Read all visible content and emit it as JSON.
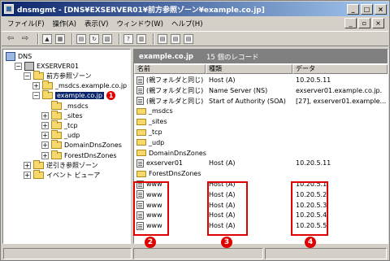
{
  "window": {
    "title": "dnsmgmt - [DNS¥EXSERVER01¥前方参照ゾーン¥example.co.jp]",
    "controls": {
      "minimize": "_",
      "maximize": "□",
      "close": "×"
    },
    "mdi_controls": {
      "minimize": "_",
      "restore": "▫",
      "close": "×"
    }
  },
  "menu": [
    "ファイル(F)",
    "操作(A)",
    "表示(V)",
    "ウィンドウ(W)",
    "ヘルプ(H)"
  ],
  "toolbar": {
    "back_glyph": "⇦",
    "forward_glyph": "⇨",
    "icons": [
      "up-folder",
      "show-tree",
      "properties",
      "refresh",
      "export-list",
      "help",
      "console-view",
      "new-host",
      "new-alias",
      "new-mail-exchanger"
    ]
  },
  "tree": [
    {
      "label": "DNS",
      "indent": 0,
      "icon": "dns-root",
      "expander": ""
    },
    {
      "label": "EXSERVER01",
      "indent": 1,
      "icon": "server",
      "expander": "−"
    },
    {
      "label": "前方参照ゾーン",
      "indent": 2,
      "icon": "folder",
      "expander": "−"
    },
    {
      "label": "_msdcs.example.co.jp",
      "indent": 3,
      "icon": "folder",
      "expander": "+"
    },
    {
      "label": "example.co.jp",
      "indent": 3,
      "icon": "folder",
      "expander": "−",
      "selected": true,
      "marker": "1"
    },
    {
      "label": "_msdcs",
      "indent": 4,
      "icon": "folder",
      "expander": ""
    },
    {
      "label": "_sites",
      "indent": 4,
      "icon": "folder",
      "expander": "+"
    },
    {
      "label": "_tcp",
      "indent": 4,
      "icon": "folder",
      "expander": "+"
    },
    {
      "label": "_udp",
      "indent": 4,
      "icon": "folder",
      "expander": "+"
    },
    {
      "label": "DomainDnsZones",
      "indent": 4,
      "icon": "folder",
      "expander": "+"
    },
    {
      "label": "ForestDnsZones",
      "indent": 4,
      "icon": "folder",
      "expander": "+"
    },
    {
      "label": "逆引き参照ゾーン",
      "indent": 2,
      "icon": "folder",
      "expander": "+"
    },
    {
      "label": "イベント ビューア",
      "indent": 2,
      "icon": "folder",
      "expander": "+"
    }
  ],
  "zone_header": {
    "name": "example.co.jp",
    "count": "15 個のレコード"
  },
  "columns": [
    "名前",
    "種類",
    "データ"
  ],
  "records": [
    {
      "icon": "record",
      "name": "(親フォルダと同じ)",
      "type": "Host (A)",
      "data": "10.20.5.11"
    },
    {
      "icon": "record",
      "name": "(親フォルダと同じ)",
      "type": "Name Server (NS)",
      "data": "exserver01.example.co.jp."
    },
    {
      "icon": "record",
      "name": "(親フォルダと同じ)",
      "type": "Start of Authority (SOA)",
      "data": "[27], exserver01.example..."
    },
    {
      "icon": "folder",
      "name": "_msdcs",
      "type": "",
      "data": ""
    },
    {
      "icon": "folder",
      "name": "_sites",
      "type": "",
      "data": ""
    },
    {
      "icon": "folder",
      "name": "_tcp",
      "type": "",
      "data": ""
    },
    {
      "icon": "folder",
      "name": "_udp",
      "type": "",
      "data": ""
    },
    {
      "icon": "folder",
      "name": "DomainDnsZones",
      "type": "",
      "data": ""
    },
    {
      "icon": "record",
      "name": "exserver01",
      "type": "Host (A)",
      "data": "10.20.5.11"
    },
    {
      "icon": "folder",
      "name": "ForestDnsZones",
      "type": "",
      "data": ""
    },
    {
      "icon": "record",
      "name": "www",
      "type": "Host (A)",
      "data": "10.20.5.1"
    },
    {
      "icon": "record",
      "name": "www",
      "type": "Host (A)",
      "data": "10.20.5.2"
    },
    {
      "icon": "record",
      "name": "www",
      "type": "Host (A)",
      "data": "10.20.5.3"
    },
    {
      "icon": "record",
      "name": "www",
      "type": "Host (A)",
      "data": "10.20.5.4"
    },
    {
      "icon": "record",
      "name": "www",
      "type": "Host (A)",
      "data": "10.20.5.5"
    }
  ],
  "callouts": [
    "2",
    "3",
    "4"
  ],
  "accent_color": "#e00000",
  "selection_color": "#0a246a"
}
